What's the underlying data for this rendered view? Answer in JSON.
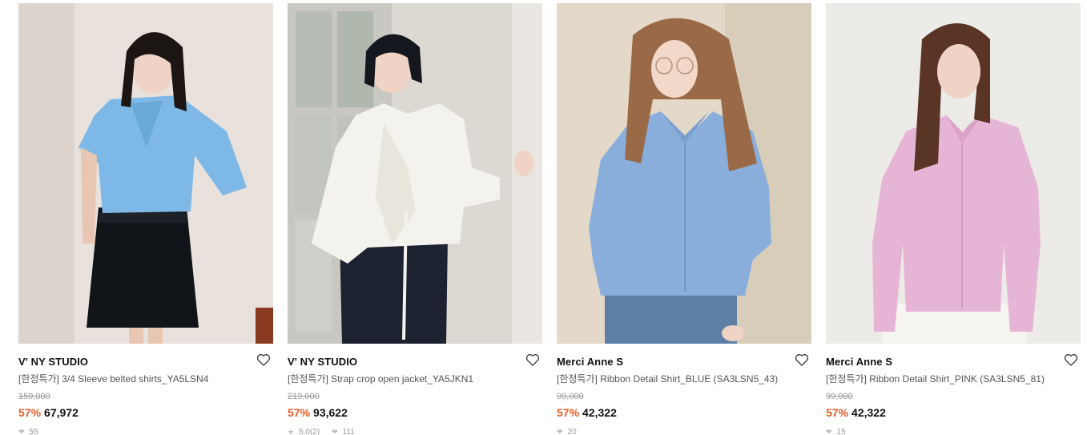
{
  "products": [
    {
      "brand": "V' NY STUDIO",
      "name": "[한정특가] 3/4 Sleeve belted shirts_YA5LSN4",
      "original_price": "159,000",
      "discount": "57%",
      "sale_price": "67,972",
      "rating": "",
      "likes": "55",
      "image": {
        "kind": "blue-shirt-black-skirt",
        "bg": "#e8e1dc",
        "top": "#7db8e6",
        "bottom": "#111418",
        "hair": "#1b1614"
      }
    },
    {
      "brand": "V' NY STUDIO",
      "name": "[한정특가] Strap crop open jacket_YA5JKN1",
      "original_price": "219,000",
      "discount": "57%",
      "sale_price": "93,622",
      "rating": "5.0(2)",
      "likes": "111",
      "image": {
        "kind": "white-jacket-navy-pants",
        "bg": "#dcd8d2",
        "top": "#f4f2ec",
        "bottom": "#1c2230",
        "hair": "#14181e"
      }
    },
    {
      "brand": "Merci Anne S",
      "name": "[한정특가] Ribbon Detail Shirt_BLUE (SA3LSN5_43)",
      "original_price": "99,000",
      "discount": "57%",
      "sale_price": "42,322",
      "rating": "",
      "likes": "20",
      "image": {
        "kind": "blue-shirt-jeans",
        "bg": "#e4d9c8",
        "top": "#8aaedb",
        "bottom": "#5d7fa6",
        "hair": "#9a6a48"
      }
    },
    {
      "brand": "Merci Anne S",
      "name": "[한정특가] Ribbon Detail Shirt_PINK (SA3LSN5_81)",
      "original_price": "99,000",
      "discount": "57%",
      "sale_price": "42,322",
      "rating": "",
      "likes": "15",
      "image": {
        "kind": "pink-shirt-white-pants",
        "bg": "#ecebe7",
        "top": "#e6b4d4",
        "bottom": "#f6f5f1",
        "hair": "#5a3526"
      }
    }
  ],
  "icons": {
    "wishlist": "heart-outline-icon",
    "like": "heart-icon",
    "rating": "star-icon"
  },
  "colors": {
    "discount": "#f05a22",
    "original_price": "#9a9a9a",
    "text": "#111111"
  }
}
